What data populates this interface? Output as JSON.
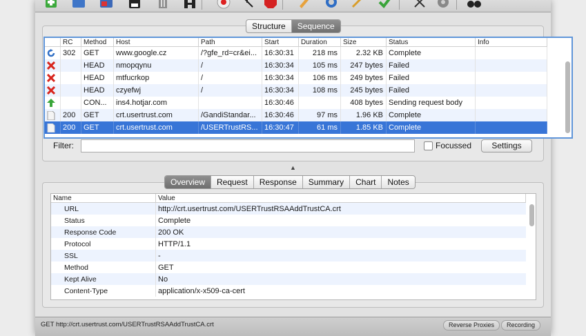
{
  "toolbar": {
    "icons": [
      "add-icon",
      "edit-icon",
      "window-icon",
      "save-icon",
      "trash-icon",
      "import-icon",
      "record-icon",
      "pointer-icon",
      "stop-icon",
      "pencil-icon",
      "refresh-icon",
      "brush-icon",
      "check-icon",
      "tools-icon",
      "gear-icon",
      "binoculars-icon"
    ]
  },
  "view_tabs": {
    "structure": "Structure",
    "sequence": "Sequence"
  },
  "sequence_table": {
    "columns": [
      "RC",
      "Method",
      "Host",
      "Path",
      "Start",
      "Duration",
      "Size",
      "Status",
      "Info"
    ],
    "rows": [
      {
        "icon": "refresh-icon",
        "rc": "302",
        "method": "GET",
        "host": "www.google.cz",
        "path": "/?gfe_rd=cr&ei...",
        "start": "16:30:31",
        "duration": "218 ms",
        "size": "2.32 KB",
        "status": "Complete",
        "info": ""
      },
      {
        "icon": "failed-icon",
        "rc": "",
        "method": "HEAD",
        "host": "nmopqynu",
        "path": "/",
        "start": "16:30:34",
        "duration": "105 ms",
        "size": "247 bytes",
        "status": "Failed",
        "info": ""
      },
      {
        "icon": "failed-icon",
        "rc": "",
        "method": "HEAD",
        "host": "mtfucrkop",
        "path": "/",
        "start": "16:30:34",
        "duration": "106 ms",
        "size": "249 bytes",
        "status": "Failed",
        "info": ""
      },
      {
        "icon": "failed-icon",
        "rc": "",
        "method": "HEAD",
        "host": "czyefwj",
        "path": "/",
        "start": "16:30:34",
        "duration": "108 ms",
        "size": "245 bytes",
        "status": "Failed",
        "info": ""
      },
      {
        "icon": "upload-arrow-icon",
        "rc": "",
        "method": "CON...",
        "host": "ins4.hotjar.com",
        "path": "",
        "start": "16:30:46",
        "duration": "",
        "size": "408 bytes",
        "status": "Sending request body",
        "info": ""
      },
      {
        "icon": "document-icon",
        "rc": "200",
        "method": "GET",
        "host": "crt.usertrust.com",
        "path": "/GandiStandar...",
        "start": "16:30:46",
        "duration": "97 ms",
        "size": "1.96 KB",
        "status": "Complete",
        "info": ""
      },
      {
        "icon": "document-icon",
        "rc": "200",
        "method": "GET",
        "host": "crt.usertrust.com",
        "path": "/USERTrustRS...",
        "start": "16:30:47",
        "duration": "61 ms",
        "size": "1.85 KB",
        "status": "Complete",
        "info": ""
      }
    ]
  },
  "filter": {
    "label": "Filter:",
    "value": "",
    "focussed_label": "Focussed",
    "settings_label": "Settings"
  },
  "detail_tabs": [
    "Overview",
    "Request",
    "Response",
    "Summary",
    "Chart",
    "Notes"
  ],
  "detail_table": {
    "columns": [
      "Name",
      "Value"
    ],
    "rows": [
      {
        "name": "URL",
        "value": "http://crt.usertrust.com/USERTrustRSAAddTrustCA.crt"
      },
      {
        "name": "Status",
        "value": "Complete"
      },
      {
        "name": "Response Code",
        "value": "200 OK"
      },
      {
        "name": "Protocol",
        "value": "HTTP/1.1"
      },
      {
        "name": "SSL",
        "value": "-"
      },
      {
        "name": "Method",
        "value": "GET"
      },
      {
        "name": "Kept Alive",
        "value": "No"
      },
      {
        "name": "Content-Type",
        "value": "application/x-x509-ca-cert"
      }
    ]
  },
  "status_bar": {
    "text": "GET http://crt.usertrust.com/USERTrustRSAAddTrustCA.crt",
    "reverse_proxies": "Reverse Proxies",
    "recording": "Recording"
  },
  "colors": {
    "selection": "#3875d7",
    "focus_ring": "#5f95d9",
    "failed": "#d8251d",
    "upload": "#3aa63a"
  }
}
